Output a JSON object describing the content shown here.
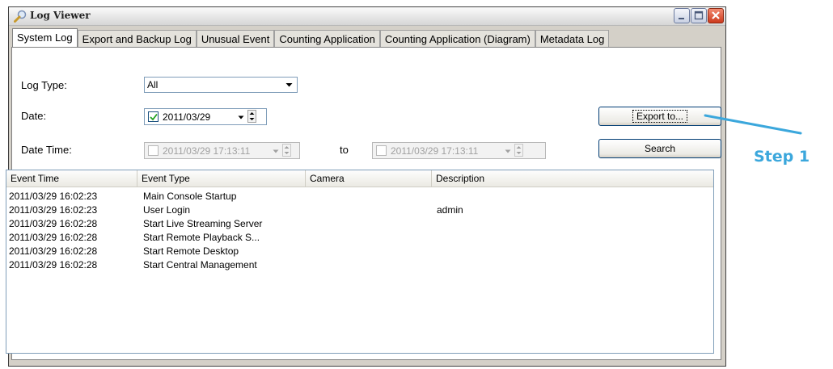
{
  "window": {
    "title": "Log Viewer"
  },
  "tabs": [
    {
      "label": "System Log",
      "active": true
    },
    {
      "label": "Export and Backup Log"
    },
    {
      "label": "Unusual Event"
    },
    {
      "label": "Counting Application"
    },
    {
      "label": "Counting Application (Diagram)"
    },
    {
      "label": "Metadata Log"
    }
  ],
  "filters": {
    "log_type_label": "Log Type:",
    "log_type_value": "All",
    "date_label": "Date:",
    "date_value": "2011/03/29",
    "datetime_label": "Date Time:",
    "datetime_from": "2011/03/29 17:13:11",
    "to_label": "to",
    "datetime_to": "2011/03/29 17:13:11"
  },
  "buttons": {
    "export": "Export to...",
    "search": "Search"
  },
  "table": {
    "columns": [
      "Event Time",
      "Event Type",
      "Camera",
      "Description"
    ],
    "rows": [
      [
        "2011/03/29 16:02:23",
        "Main Console Startup",
        "",
        ""
      ],
      [
        "2011/03/29 16:02:23",
        "User Login",
        "",
        "admin"
      ],
      [
        "2011/03/29 16:02:28",
        "Start Live Streaming Server",
        "",
        ""
      ],
      [
        "2011/03/29 16:02:28",
        "Start Remote Playback S...",
        "",
        ""
      ],
      [
        "2011/03/29 16:02:28",
        "Start Remote Desktop",
        "",
        ""
      ],
      [
        "2011/03/29 16:02:28",
        "Start Central Management",
        "",
        ""
      ]
    ]
  },
  "annotation": {
    "step_label": "Step 1",
    "color": "#3ba7dc"
  }
}
